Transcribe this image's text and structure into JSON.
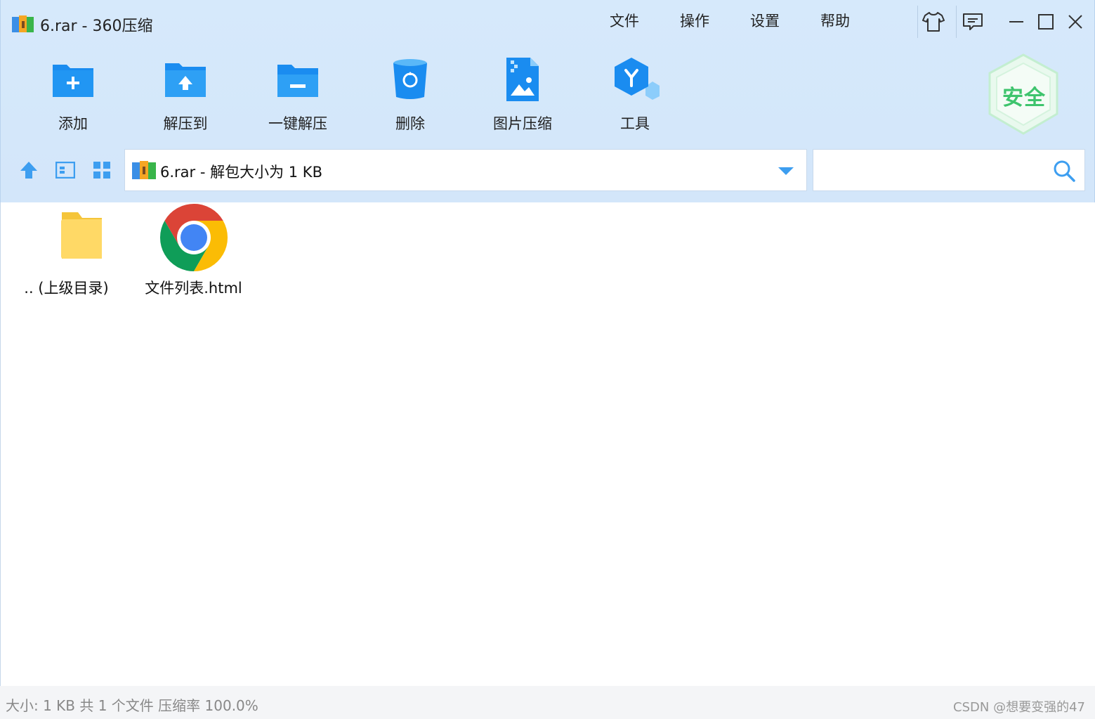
{
  "window": {
    "title": "6.rar - 360压缩"
  },
  "menu": [
    "文件",
    "操作",
    "设置",
    "帮助"
  ],
  "toolbar": {
    "add": "添加",
    "extract_to": "解压到",
    "one_click_extract": "一键解压",
    "delete": "删除",
    "image_compress": "图片压缩",
    "tools": "工具"
  },
  "badge": {
    "text": "安全"
  },
  "path": {
    "text": "6.rar - 解包大小为 1 KB"
  },
  "search": {
    "placeholder": ""
  },
  "files": [
    {
      "name": ".. (上级目录)",
      "icon": "folder-icon"
    },
    {
      "name": "文件列表.html",
      "icon": "chrome-icon"
    }
  ],
  "status": {
    "text": "大小: 1 KB 共 1 个文件 压缩率 100.0%"
  },
  "watermark": "CSDN @想要变强的47",
  "colors": {
    "accent": "#1a8cf0",
    "header_bg": "#d6e9fb",
    "badge_green": "#3ec46d"
  }
}
